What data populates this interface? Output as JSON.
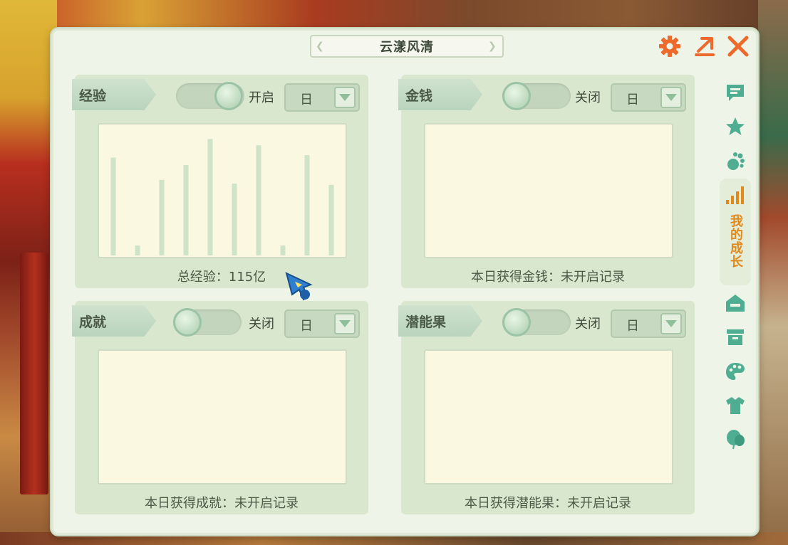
{
  "window": {
    "title": "云漾风清"
  },
  "top_actions": [
    {
      "name": "settings-gear-icon"
    },
    {
      "name": "share-export-icon"
    },
    {
      "name": "close-icon"
    }
  ],
  "side_tabs": {
    "active_label": "我的成长",
    "items": [
      "chat-bubble-icon",
      "star-icon",
      "pawprint-icon",
      "growth-bars-icon",
      "home-icon",
      "storage-box-icon",
      "palette-icon",
      "clothing-shirt-icon",
      "balloon-icon"
    ]
  },
  "cards": [
    {
      "id": "experience",
      "label": "经验",
      "toggle_on": true,
      "state_text": "开启",
      "period": "日",
      "caption": "总经验：115亿",
      "chart_data": {
        "type": "bar",
        "values": [
          0.79,
          0.08,
          0.61,
          0.73,
          0.94,
          0.58,
          0.89,
          0.08,
          0.81,
          0.57
        ]
      }
    },
    {
      "id": "money",
      "label": "金钱",
      "toggle_on": false,
      "state_text": "关闭",
      "period": "日",
      "caption": "本日获得金钱：未开启记录"
    },
    {
      "id": "achievement",
      "label": "成就",
      "toggle_on": false,
      "state_text": "关闭",
      "period": "日",
      "caption": "本日获得成就：未开启记录"
    },
    {
      "id": "potential-fruit",
      "label": "潜能果",
      "toggle_on": false,
      "state_text": "关闭",
      "period": "日",
      "caption": "本日获得潜能果：未开启记录"
    }
  ],
  "colors": {
    "accent_orange": "#ec6a2b",
    "panel_bg": "#eef4e7",
    "bar": "#cfe3c8"
  }
}
